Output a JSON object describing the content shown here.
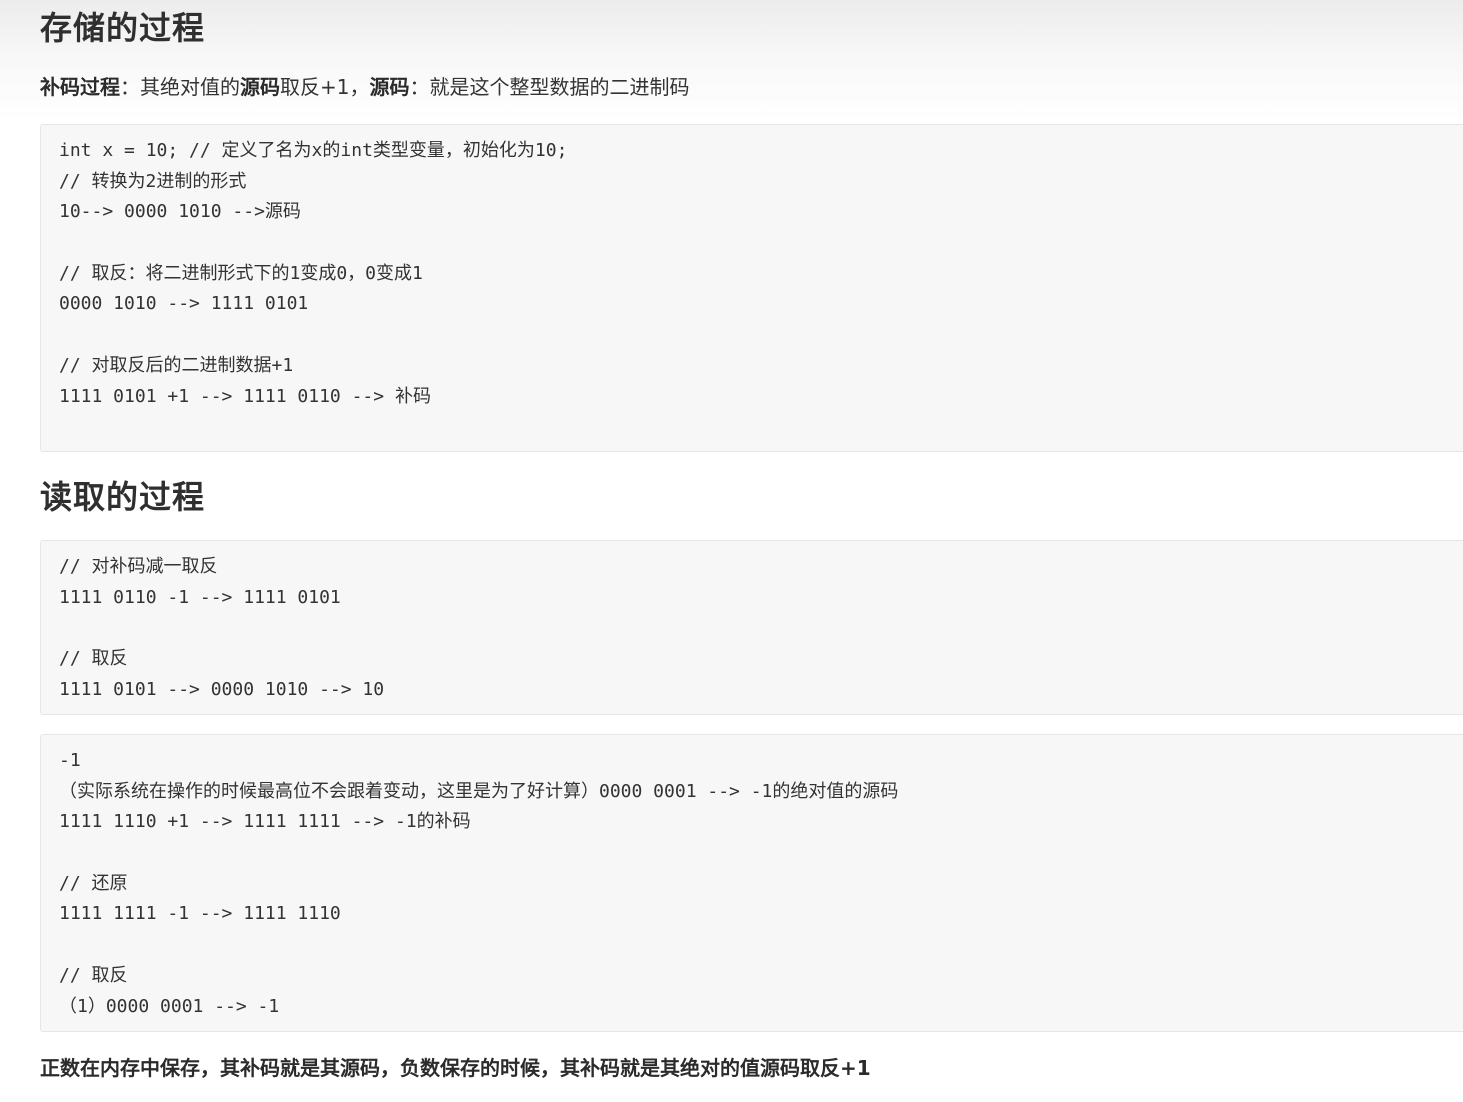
{
  "section1": {
    "heading": "存储的过程",
    "intro": {
      "label1": "补码过程",
      "sep1": "：其绝对值的",
      "term1": "源码",
      "text1": "取反+1，",
      "label2": "源码",
      "text2": "：就是这个整型数据的二进制码"
    },
    "code": [
      "int x = 10; // 定义了名为x的int类型变量，初始化为10;",
      "// 转换为2进制的形式",
      "10--> 0000 1010 -->源码",
      "",
      "// 取反：将二进制形式下的1变成0，0变成1",
      "0000 1010 --> 1111 0101",
      "",
      "// 对取反后的二进制数据+1",
      "1111 0101 +1 --> 1111 0110 --> 补码",
      ""
    ]
  },
  "section2": {
    "heading": "读取的过程",
    "code1": [
      "// 对补码减一取反",
      "1111 0110 -1 --> 1111 0101",
      "",
      "// 取反",
      "1111 0101 --> 0000 1010 --> 10"
    ],
    "code2": [
      "-1",
      "（实际系统在操作的时候最高位不会跟着变动，这里是为了好计算）0000 0001 --> -1的绝对值的源码",
      "1111 1110 +1 --> 1111 1111 --> -1的补码",
      "",
      "// 还原",
      "1111 1111 -1 --> 1111 1110",
      "",
      "// 取反",
      "（1）0000 0001 --> -1"
    ]
  },
  "conclusion": "正数在内存中保存，其补码就是其源码，负数保存的时候，其补码就是其绝对的值源码取反+1"
}
